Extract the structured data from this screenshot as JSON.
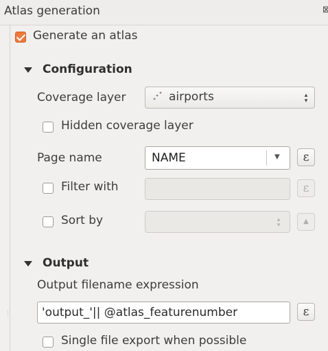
{
  "panel": {
    "title": "Atlas generation",
    "float_icon": "⊠"
  },
  "generate": {
    "label": "Generate an atlas",
    "checked": true
  },
  "configuration": {
    "title": "Configuration",
    "coverage_layer_label": "Coverage layer",
    "coverage_layer_value": "airports",
    "coverage_layer_icon": "point-layer-icon",
    "hidden_coverage_label": "Hidden coverage layer",
    "hidden_coverage_checked": false,
    "page_name_label": "Page name",
    "page_name_value": "NAME",
    "filter_label": "Filter with",
    "filter_checked": false,
    "sort_label": "Sort by",
    "sort_checked": false,
    "expression_glyph": "ε"
  },
  "output": {
    "title": "Output",
    "filename_expression_label": "Output filename expression",
    "filename_expression_value": "'output_'|| @atlas_featurenumber",
    "single_file_label": "Single file export when possible",
    "single_file_checked": false
  },
  "colors": {
    "accent": "#ec7a3d",
    "background": "#f1f0ee"
  }
}
